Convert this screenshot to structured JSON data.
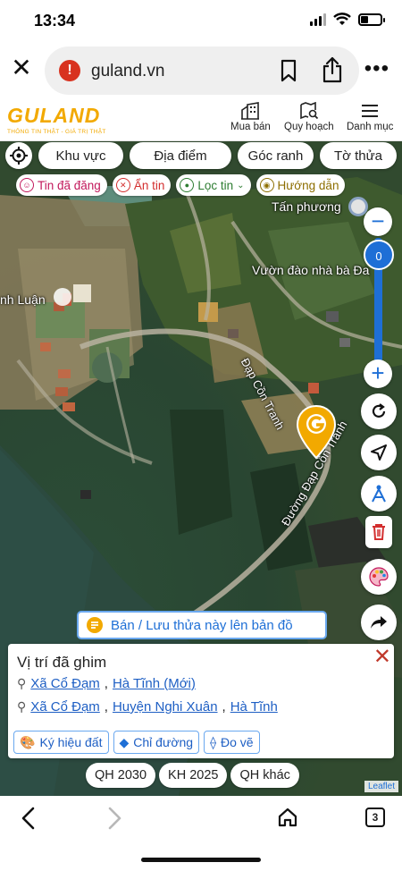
{
  "status": {
    "time": "13:34"
  },
  "browser": {
    "url": "guland.vn",
    "tab_count": "3"
  },
  "header": {
    "logo": "GULAND",
    "tagline": "THÔNG TIN THẬT - GIÁ TRỊ THẬT",
    "nav": [
      "Mua bán",
      "Quy hoạch",
      "Danh mục"
    ]
  },
  "search_chips": [
    "Khu vực",
    "Địa điểm",
    "Góc ranh",
    "Tờ thửa"
  ],
  "filters": [
    {
      "label": "Tin đã đăng",
      "color": "#c2185b",
      "icon": "emoji-icon"
    },
    {
      "label": "Ẩn tin",
      "color": "#d32f2f",
      "icon": "close-circle-icon"
    },
    {
      "label": "Lọc tin",
      "color": "#2e7d32",
      "icon": "filter-icon"
    },
    {
      "label": "Hướng dẫn",
      "color": "#8d6e00",
      "icon": "guide-icon"
    }
  ],
  "map_labels": {
    "place_1": "Tấn phương",
    "place_2": "Vườn đào nhà bà Đa",
    "place_3": "nh Luận",
    "road_1": "Đạp Cồn Tranh",
    "road_2": "Đường Đạp Cồn Tranh"
  },
  "zoom_level": "0",
  "sell_button": "Bán / Lưu thửa này lên bản đồ",
  "info": {
    "title": "Vị trí đã ghim",
    "addr1": [
      "Xã Cổ Đạm",
      "Hà Tĩnh (Mới)"
    ],
    "addr2": [
      "Xã Cổ Đạm",
      "Huyện Nghi Xuân",
      "Hà Tĩnh"
    ],
    "actions": [
      "Ký hiệu đất",
      "Chỉ đường",
      "Đo vẽ"
    ]
  },
  "plan_chips": [
    "QH 2030",
    "KH 2025",
    "QH khác"
  ],
  "attribution": "Leaflet",
  "colors": {
    "brand": "#f2a900",
    "accent": "#1e6fd6",
    "close": "#c0392b"
  }
}
